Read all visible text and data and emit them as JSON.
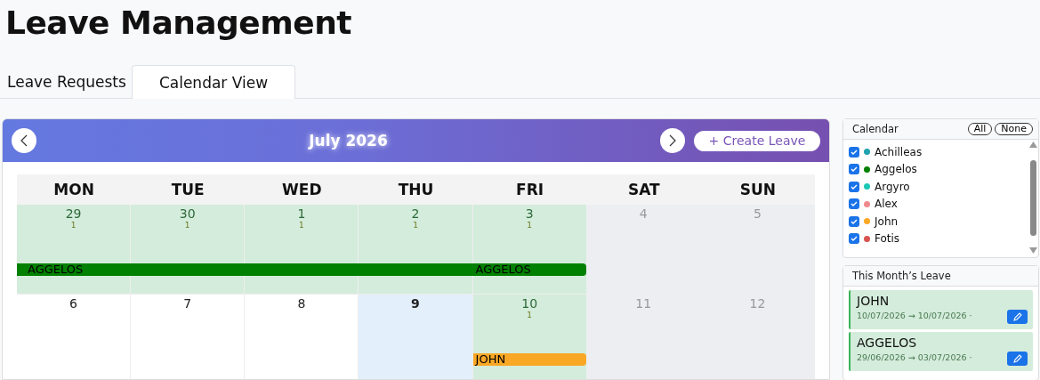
{
  "page_title": "Leave Management",
  "tabs": [
    {
      "label": "Leave Requests",
      "selected": false
    },
    {
      "label": "Calendar View",
      "selected": true
    }
  ],
  "calendar": {
    "month": "July 2026",
    "create_button": "+ Create Leave",
    "weekdays": [
      "MON",
      "TUE",
      "WED",
      "THU",
      "FRI",
      "SAT",
      "SUN"
    ],
    "weeks": [
      {
        "days": [
          {
            "date": "29",
            "count": "1",
            "kind": "leave",
            "bar": {
              "label": "AGGELOS",
              "color": "#008000",
              "end": false
            }
          },
          {
            "date": "30",
            "count": "1",
            "kind": "leave",
            "bar": {
              "color": "#008000",
              "end": false
            }
          },
          {
            "date": "1",
            "count": "1",
            "kind": "leave",
            "bar": {
              "color": "#008000",
              "end": false
            }
          },
          {
            "date": "2",
            "count": "1",
            "kind": "leave",
            "bar": {
              "color": "#008000",
              "end": false
            }
          },
          {
            "date": "3",
            "count": "1",
            "kind": "leave",
            "bar": {
              "label": "AGGELOS",
              "color": "#008000",
              "end": true
            }
          },
          {
            "date": "4",
            "kind": "weekend"
          },
          {
            "date": "5",
            "kind": "weekend"
          }
        ]
      },
      {
        "days": [
          {
            "date": "6",
            "kind": "normal"
          },
          {
            "date": "7",
            "kind": "normal"
          },
          {
            "date": "8",
            "kind": "normal"
          },
          {
            "date": "9",
            "kind": "today"
          },
          {
            "date": "10",
            "count": "1",
            "kind": "leave",
            "bar": {
              "label": "JOHN",
              "color": "#f9a825",
              "end": true
            }
          },
          {
            "date": "11",
            "kind": "weekend"
          },
          {
            "date": "12",
            "kind": "weekend"
          }
        ]
      }
    ]
  },
  "filter": {
    "title": "Calendar",
    "buttons": [
      "All",
      "None"
    ],
    "people": [
      {
        "name": "Achilleas",
        "checked": true,
        "color": "#1fa2b0"
      },
      {
        "name": "Aggelos",
        "checked": true,
        "color": "#008000"
      },
      {
        "name": "Argyro",
        "checked": true,
        "color": "#1cc7b5"
      },
      {
        "name": "Alex",
        "checked": true,
        "color": "#f08a8a"
      },
      {
        "name": "John",
        "checked": true,
        "color": "#f9a825"
      },
      {
        "name": "Fotis",
        "checked": true,
        "color": "#d9534f"
      }
    ]
  },
  "month_leave": {
    "title": "This Month’s Leave",
    "items": [
      {
        "name": "JOHN",
        "range": "10/07/2026 → 10/07/2026 ·"
      },
      {
        "name": "AGGELOS",
        "range": "29/06/2026 → 03/07/2026 ·"
      }
    ]
  }
}
